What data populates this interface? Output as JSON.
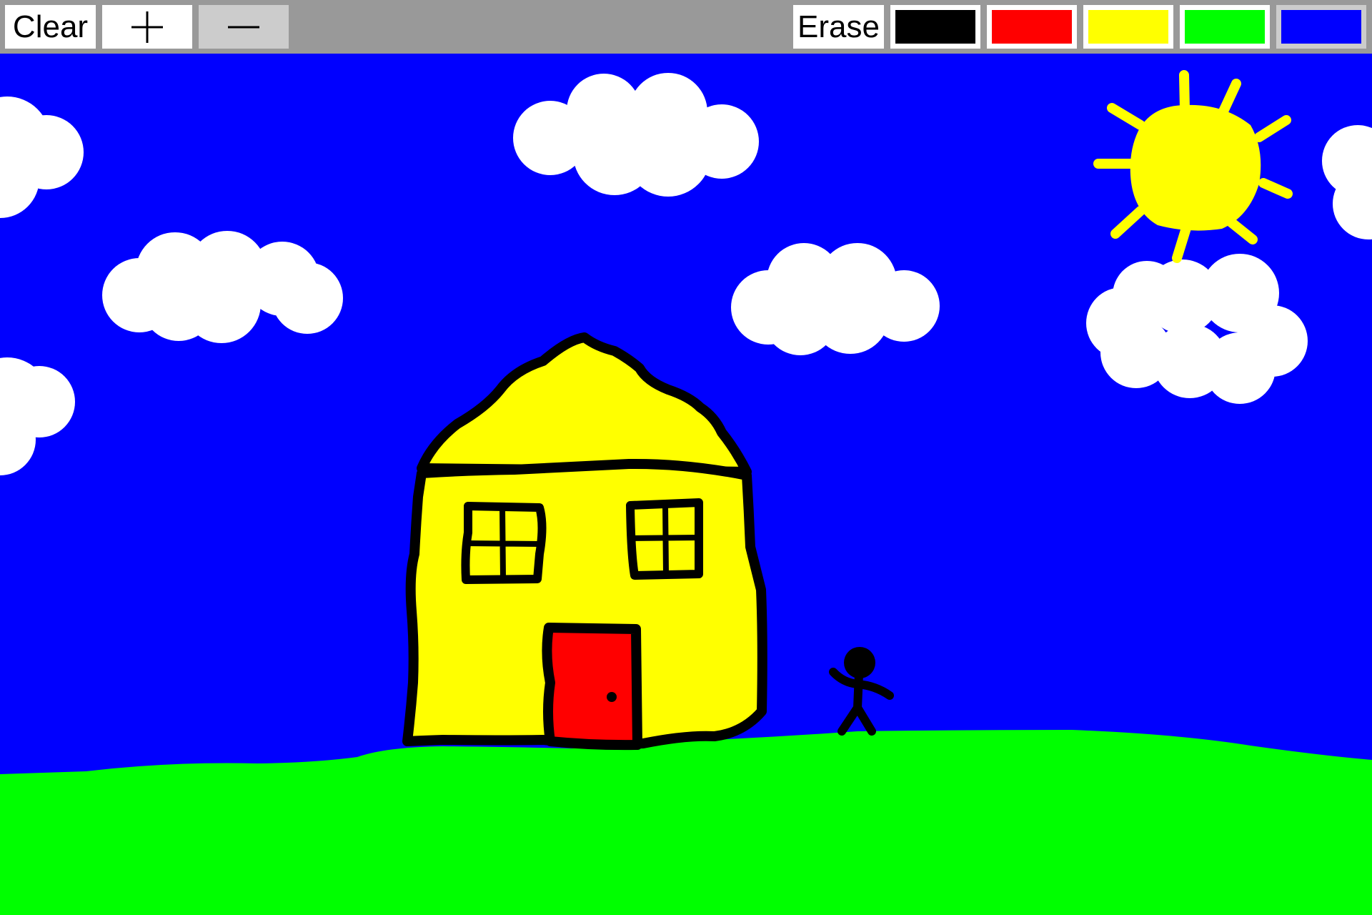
{
  "toolbar": {
    "clear_label": "Clear",
    "grow_symbol": "+",
    "shrink_symbol": "—",
    "erase_label": "Erase",
    "palette": [
      {
        "name": "black",
        "color": "#000000"
      },
      {
        "name": "red",
        "color": "#ff0000"
      },
      {
        "name": "yellow",
        "color": "#ffff00"
      },
      {
        "name": "green",
        "color": "#00ff00"
      },
      {
        "name": "blue",
        "color": "#0000ff"
      }
    ],
    "selected_color": "blue"
  },
  "canvas": {
    "sky_color": "#0000ff",
    "ground_color": "#00ff00",
    "cloud_color": "#ffffff",
    "sun_color": "#ffff00",
    "house_wall_color": "#ffff00",
    "house_door_color": "#ff0000",
    "outline_color": "#000000"
  }
}
